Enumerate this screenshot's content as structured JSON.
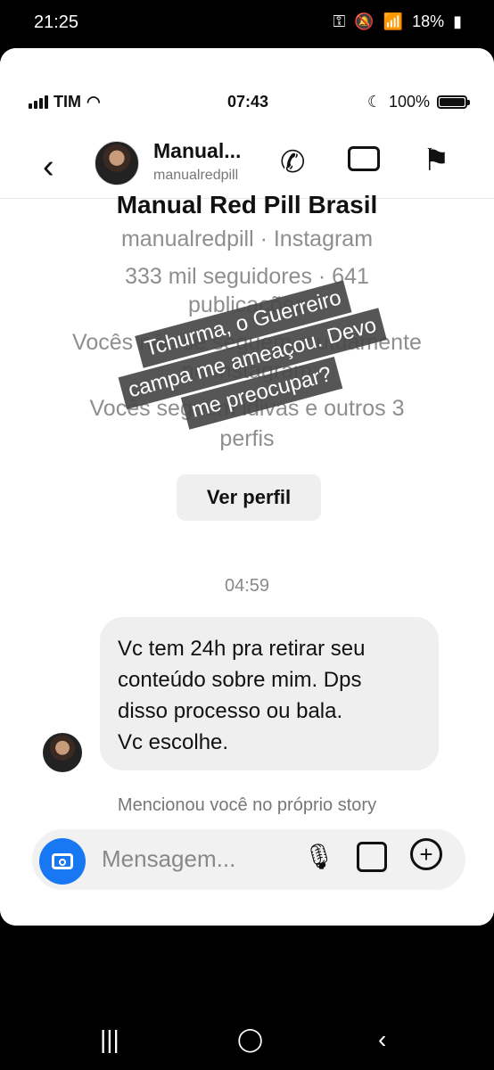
{
  "outer_status": {
    "time": "21:25",
    "battery": "18%"
  },
  "ios_status": {
    "carrier": "TIM",
    "time": "07:43",
    "battery": "100%",
    "battery_level": 1.0
  },
  "chat_header": {
    "name": "Manual...",
    "handle": "manualredpill"
  },
  "profile": {
    "title": "Manual Red Pill Brasil",
    "subtitle": "manualredpill · Instagram",
    "stats_line1": "333 mil seguidores · 641",
    "stats_line2": "publicações",
    "mutual_line1": "Vocês não se seguem mutuamente",
    "mutual_line2": "no Instagram",
    "followed_line1": "Vocês seguem idivas e outros 3",
    "followed_line2": "perfis",
    "view_profile": "Ver perfil"
  },
  "thread": {
    "timestamp": "04:59",
    "message_lines": [
      "Vc tem 24h pra retirar seu",
      "conteúdo sobre mim. Dps",
      "disso processo ou bala.",
      "Vc escolhe."
    ],
    "mention_text": "Mencionou você no próprio story"
  },
  "composer": {
    "placeholder": "Mensagem..."
  },
  "story_overlay": {
    "lines": [
      "Tchurma, o Guerreiro",
      "campa me ameaçou. Devo",
      "me preocupar?"
    ]
  },
  "icons": {
    "camera": "camera-icon",
    "mic": "mic-icon",
    "gallery": "image-icon",
    "plus": "plus-icon",
    "phone": "phone-icon",
    "video": "video-icon",
    "flag": "flag-icon",
    "back": "chevron-left-icon"
  }
}
